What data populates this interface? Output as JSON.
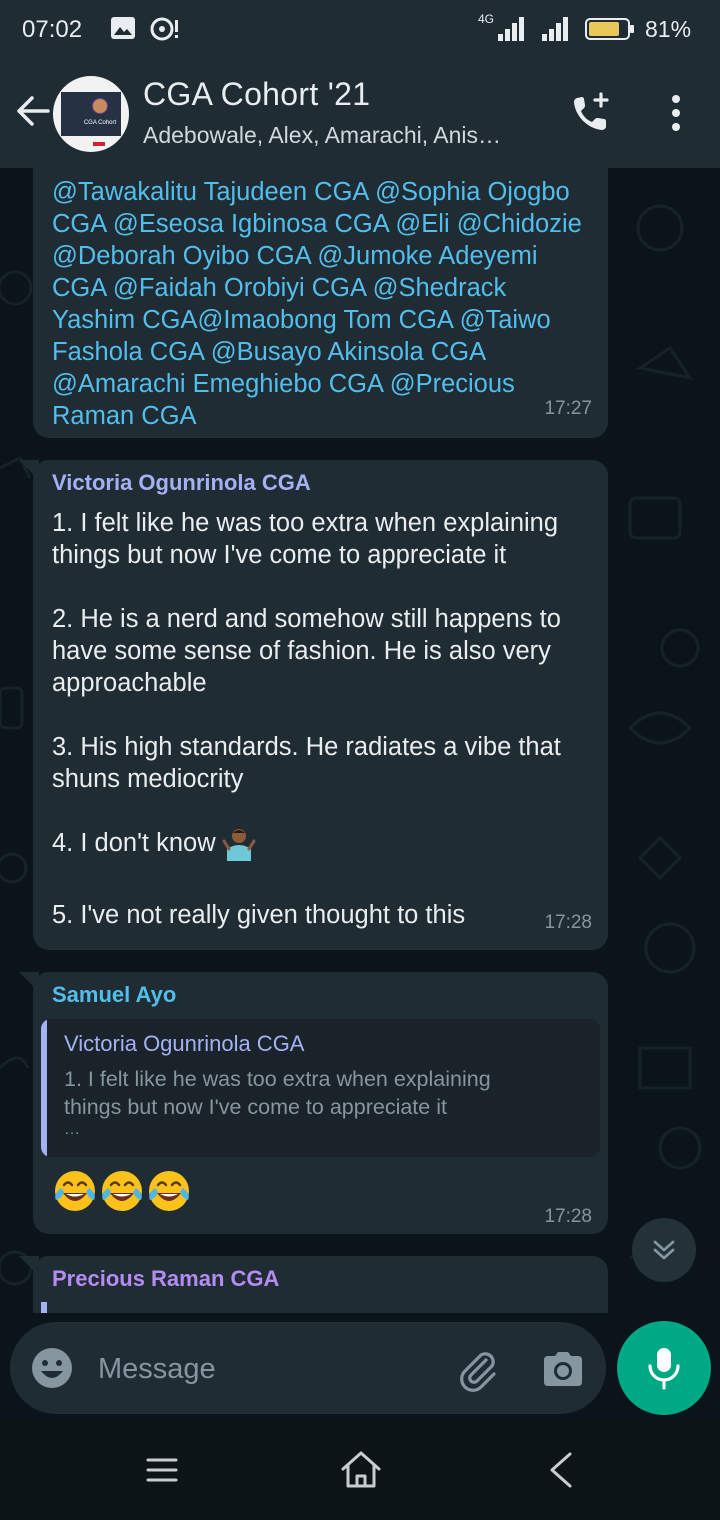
{
  "status_bar": {
    "time": "07:02",
    "network": "4G",
    "battery_percent": "81%",
    "battery_level": 0.81
  },
  "header": {
    "title": "CGA Cohort '21",
    "subtitle": "Adebowale, Alex, Amarachi, Anis…",
    "avatar_caption": "CGA Cohort"
  },
  "messages": [
    {
      "mentions_text": "@Tawakalitu Tajudeen CGA @Sophia Ojogbo CGA @Eseosa Igbinosa CGA @Eli @Chidozie @Deborah Oyibo CGA @Jumoke Adeyemi CGA @Faidah Orobiyi CGA @Shedrack Yashim CGA@Imaobong Tom CGA @Taiwo Fashola CGA @Busayo Akinsola CGA @Amarachi Emeghiebo CGA @Precious Raman CGA",
      "time": "17:27"
    },
    {
      "sender": "Victoria Ogunrinola CGA",
      "sender_color": "#a5b1f5",
      "lines": [
        "1. I felt like he was too extra when explaining things but now I've come to appreciate it",
        "2. He is a nerd and somehow still happens to have some sense of fashion. He is also very approachable",
        "3. His high standards. He radiates a vibe that shuns mediocrity",
        "4. I don't know",
        "5. I've not really given thought to this"
      ],
      "time": "17:28"
    },
    {
      "sender": "Samuel Ayo",
      "sender_color": "#53bdeb",
      "quote": {
        "sender": "Victoria Ogunrinola CGA",
        "text_line1": "1. I felt like he was too extra when explaining",
        "text_line2": "things but now I've come to appreciate it",
        "ellipsis": "…"
      },
      "emoji": [
        "face-with-tears-of-joy",
        "face-with-tears-of-joy",
        "face-with-tears-of-joy"
      ],
      "time": "17:28"
    },
    {
      "sender": "Precious Raman CGA",
      "sender_color": "#b48cf2"
    }
  ],
  "composer": {
    "placeholder": "Message"
  },
  "colors": {
    "header_bg": "#1f2c34",
    "chat_bg": "#0b141a",
    "bubble_bg": "#202c33",
    "mention": "#53bdeb",
    "accent": "#00a884"
  }
}
